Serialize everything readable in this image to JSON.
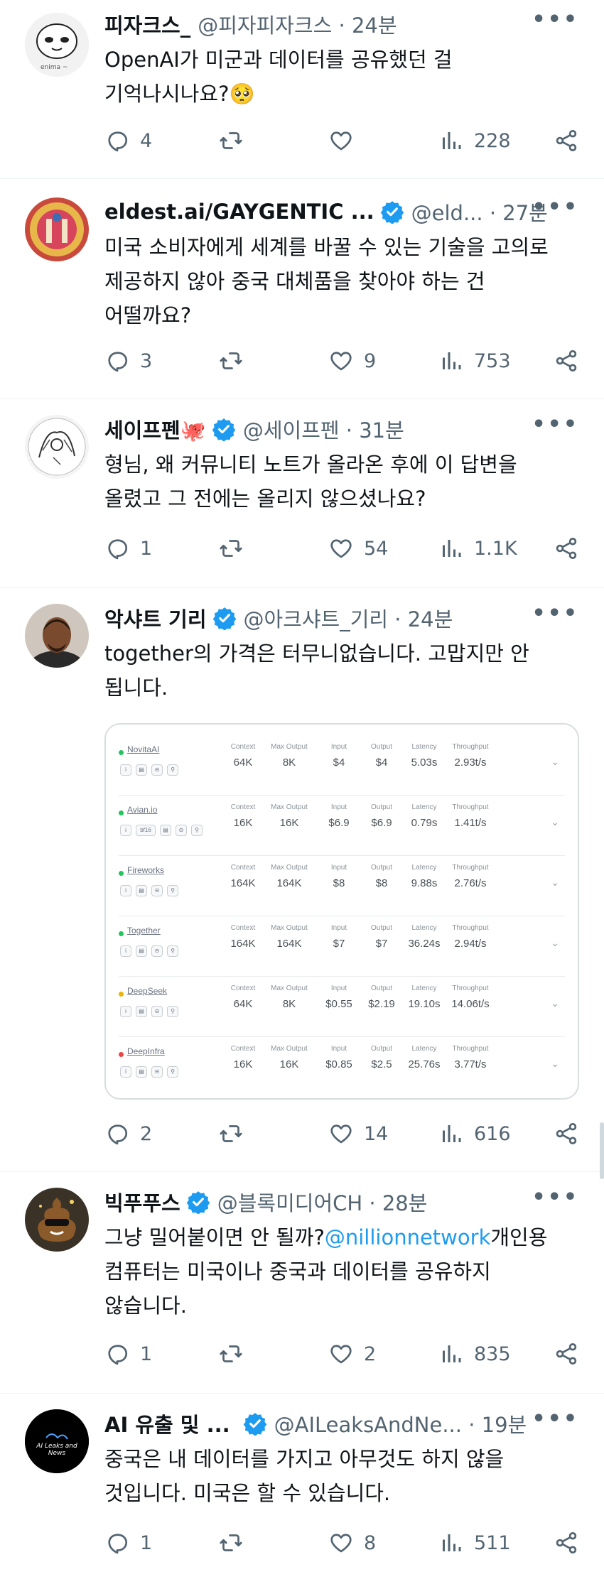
{
  "tweets": [
    {
      "name": "피자크스_",
      "handle": "@피자피자크스 · 24분",
      "verified": false,
      "text": "OpenAI가 미군과 데이터를 공유했던 걸 기억나시나요?🥺",
      "avatar_caption": "enima ~",
      "replies": "4",
      "retweets": "",
      "likes": "",
      "views": "228"
    },
    {
      "name": "eldest.ai/GAYGENTIC ...",
      "handle": "@eld... · 27분",
      "verified": true,
      "text": "미국 소비자에게 세계를 바꿀 수 있는 기술을 고의로 제공하지 않아 중국 대체품을 찾아야 하는 건 어떨까요?",
      "replies": "3",
      "retweets": "",
      "likes": "9",
      "views": "753"
    },
    {
      "name": "세이프펜🐙",
      "handle": "@세이프펜 · 31분",
      "verified": true,
      "text": "형님, 왜 커뮤니티 노트가 올라온 후에 이 답변을 올렸고 그 전에는 올리지 않으셨나요?",
      "replies": "1",
      "retweets": "",
      "likes": "54",
      "views": "1.1K"
    },
    {
      "name": "악샤트 기리",
      "handle": "@아크샤트_기리 · 24분",
      "verified": true,
      "text": "together의 가격은 터무니없습니다. 고맙지만 안 됩니다.",
      "replies": "2",
      "retweets": "",
      "likes": "14",
      "views": "616"
    },
    {
      "name": "빅푸푸스",
      "handle": "@블록미디어CH · 28분",
      "verified": true,
      "text_before": "그냥 밀어붙이면 안 될까?",
      "mention": "@nillionnetwork",
      "text_after": "개인용 컴퓨터는 미국이나 중국과 데이터를 공유하지 않습니다.",
      "replies": "1",
      "retweets": "",
      "likes": "2",
      "views": "835"
    },
    {
      "name": "AI 유출 및 ...",
      "handle": "@AILeaksAndNe... · 19분",
      "verified": true,
      "text": "중국은 내 데이터를 가지고 아무것도 하지 않을 것입니다. 미국은 할 수 있습니다.",
      "avatar_caption": "AI Leaks and News",
      "replies": "1",
      "retweets": "",
      "likes": "8",
      "views": "511"
    }
  ],
  "more_label": "•••",
  "provider_table": {
    "columns": [
      "Context",
      "Max Output",
      "Input",
      "Output",
      "Latency",
      "Throughput"
    ],
    "rows": [
      {
        "name": "NovitaAI",
        "dot": "#22c55e",
        "extra_tag": "",
        "values": [
          "64K",
          "8K",
          "$4",
          "$4",
          "5.03s",
          "2.93t/s"
        ]
      },
      {
        "name": "Avian.io",
        "dot": "#22c55e",
        "extra_tag": "bf16",
        "values": [
          "16K",
          "16K",
          "$6.9",
          "$6.9",
          "0.79s",
          "1.41t/s"
        ]
      },
      {
        "name": "Fireworks",
        "dot": "#22c55e",
        "extra_tag": "",
        "values": [
          "164K",
          "164K",
          "$8",
          "$8",
          "9.88s",
          "2.76t/s"
        ]
      },
      {
        "name": "Together",
        "dot": "#22c55e",
        "extra_tag": "",
        "values": [
          "164K",
          "164K",
          "$7",
          "$7",
          "36.24s",
          "2.94t/s"
        ]
      },
      {
        "name": "DeepSeek",
        "dot": "#eab308",
        "extra_tag": "",
        "values": [
          "64K",
          "8K",
          "$0.55",
          "$2.19",
          "19.10s",
          "14.06t/s"
        ]
      },
      {
        "name": "DeepInfra",
        "dot": "#ef4444",
        "extra_tag": "",
        "values": [
          "16K",
          "16K",
          "$0.85",
          "$2.5",
          "25.76s",
          "3.77t/s"
        ]
      }
    ]
  },
  "colors": {
    "text": "#0f1419",
    "muted": "#536471",
    "link": "#1d9bf0",
    "verified": "#1d9bf0"
  }
}
